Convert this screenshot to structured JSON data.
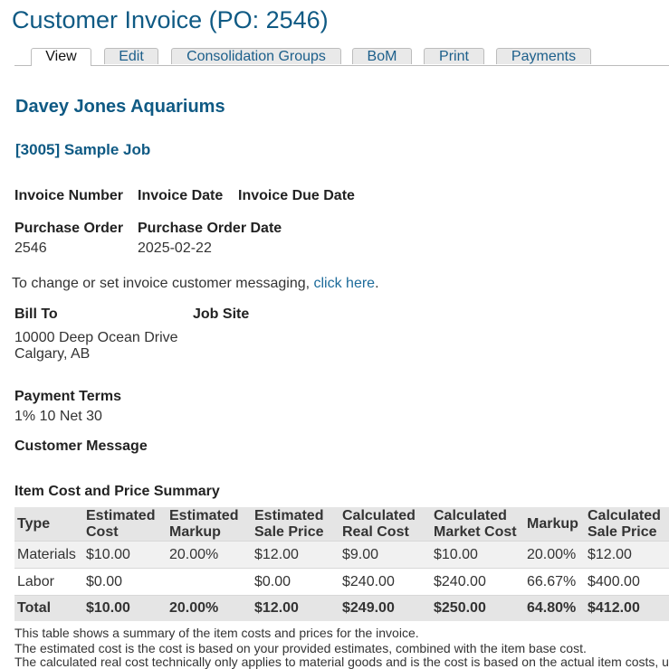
{
  "page_title": "Customer Invoice (PO: 2546)",
  "tabs": [
    "View",
    "Edit",
    "Consolidation Groups",
    "BoM",
    "Print",
    "Payments"
  ],
  "active_tab": "View",
  "company": "Davey Jones Aquariums",
  "job": "[3005] Sample Job",
  "labels": {
    "invoice_number": "Invoice Number",
    "invoice_date": "Invoice Date",
    "invoice_due_date": "Invoice Due Date",
    "purchase_order": "Purchase Order",
    "purchase_order_date": "Purchase Order Date",
    "bill_to": "Bill To",
    "job_site": "Job Site",
    "payment_terms": "Payment Terms",
    "customer_message": "Customer Message",
    "summary_title": "Item Cost and Price Summary"
  },
  "values": {
    "purchase_order": "2546",
    "purchase_order_date": "2025-02-22",
    "bill_to_line1": "10000 Deep Ocean Drive",
    "bill_to_line2": "Calgary, AB",
    "payment_terms": "1% 10 Net 30"
  },
  "messaging": {
    "prefix": "To change or set invoice customer messaging, ",
    "link": "click here",
    "suffix": "."
  },
  "summary": {
    "headers": [
      [
        "Type",
        ""
      ],
      [
        "Estimated",
        "Cost"
      ],
      [
        "Estimated",
        "Markup"
      ],
      [
        "Estimated",
        "Sale Price"
      ],
      [
        "Calculated",
        "Real Cost"
      ],
      [
        "Calculated",
        "Market Cost"
      ],
      [
        "Markup",
        ""
      ],
      [
        "Calculated",
        "Sale Price"
      ]
    ],
    "rows": [
      [
        "Materials",
        "$10.00",
        "20.00%",
        "$12.00",
        "$9.00",
        "$10.00",
        "20.00%",
        "$12.00"
      ],
      [
        "Labor",
        "$0.00",
        "",
        "$0.00",
        "$240.00",
        "$240.00",
        "66.67%",
        "$400.00"
      ]
    ],
    "total": [
      "Total",
      "$10.00",
      "20.00%",
      "$12.00",
      "$249.00",
      "$250.00",
      "64.80%",
      "$412.00"
    ]
  },
  "notes": [
    "This table shows a summary of the item costs and prices for the invoice.",
    "The estimated cost is the cost is based on your provided estimates, combined with the item base cost.",
    "The calculated real cost technically only applies to material goods and is the cost is based on the actual item costs, using"
  ]
}
